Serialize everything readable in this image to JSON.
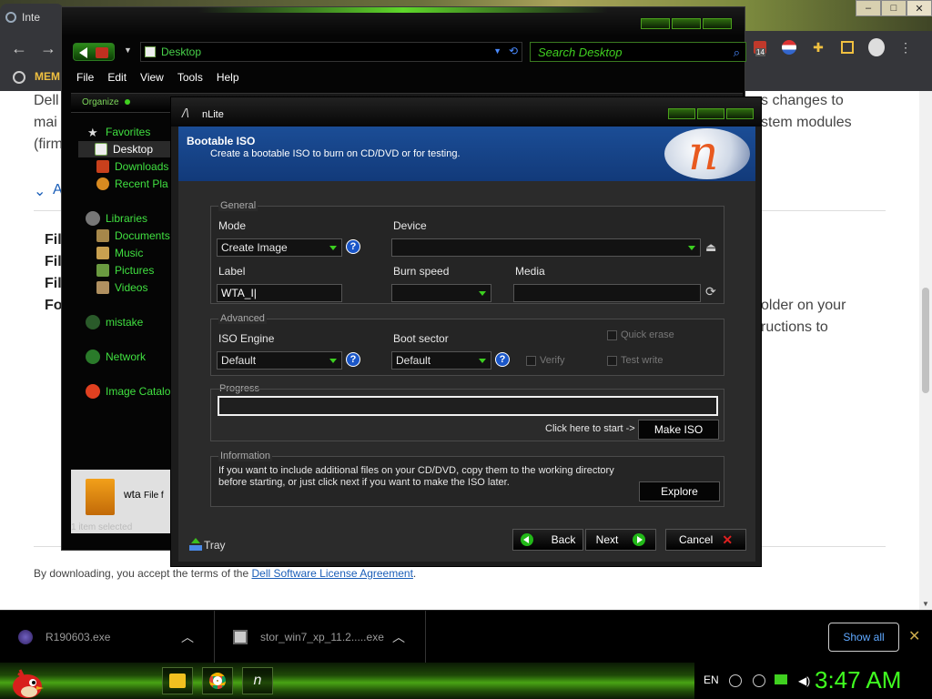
{
  "browser": {
    "tab_title": "Inte",
    "bookmark": "MEM",
    "extension_badge": "14",
    "page_lines": [
      "Dell",
      "mai",
      "(firm",
      "s changes to",
      "stem modules",
      "older on your",
      "ructions to"
    ],
    "section_marker": "A",
    "file_list_prefixes": [
      "Fil",
      "Fil",
      "Fil",
      "Fo"
    ],
    "footer_text": "By downloading, you accept the terms of the",
    "footer_link": "Dell Software License Agreement",
    "footer_end": "."
  },
  "downloads": {
    "items": [
      {
        "name": "R190603.exe"
      },
      {
        "name": "stor_win7_xp_11.2.....exe"
      }
    ],
    "show_all": "Show all"
  },
  "explorer": {
    "address": "Desktop",
    "search_placeholder": "Search Desktop",
    "menu": [
      "File",
      "Edit",
      "View",
      "Tools",
      "Help"
    ],
    "organize": "Organize",
    "nav": [
      {
        "label": "Favorites",
        "icon": "star-icon"
      },
      {
        "label": "Desktop",
        "icon": "desktop-icon"
      },
      {
        "label": "Downloads",
        "icon": "downloads-icon"
      },
      {
        "label": "Recent Pla",
        "icon": "recent-places-icon"
      },
      {
        "label": "Libraries",
        "icon": "libraries-icon"
      },
      {
        "label": "Documents",
        "icon": "documents-icon"
      },
      {
        "label": "Music",
        "icon": "music-icon"
      },
      {
        "label": "Pictures",
        "icon": "pictures-icon"
      },
      {
        "label": "Videos",
        "icon": "videos-icon"
      },
      {
        "label": "mistake",
        "icon": "homegroup-icon"
      },
      {
        "label": "Network",
        "icon": "network-icon"
      },
      {
        "label": "Image Catalo",
        "icon": "image-catalog-icon"
      }
    ],
    "selected_file": "wta",
    "selected_file_type": "File f",
    "status": "1 item selected"
  },
  "nlite": {
    "title": "nLite",
    "header_title": "Bootable ISO",
    "header_subtitle": "Create a bootable ISO to burn on CD/DVD or for testing.",
    "general": {
      "group": "General",
      "mode_label": "Mode",
      "mode_value": "Create Image",
      "device_label": "Device",
      "device_value": "",
      "label_label": "Label",
      "label_value": "WTA_I",
      "burn_speed_label": "Burn speed",
      "burn_speed_value": "",
      "media_label": "Media",
      "media_value": ""
    },
    "advanced": {
      "group": "Advanced",
      "iso_engine_label": "ISO Engine",
      "iso_engine_value": "Default",
      "boot_sector_label": "Boot sector",
      "boot_sector_value": "Default",
      "verify_label": "Verify",
      "quick_erase_label": "Quick erase",
      "test_write_label": "Test write"
    },
    "progress": {
      "group": "Progress",
      "percent": 0,
      "hint": "Click here to start ->",
      "make_iso": "Make ISO"
    },
    "information": {
      "group": "Information",
      "text_line1": "If you want to include additional files on your CD/DVD, copy them to the working directory",
      "text_line2": "before starting, or just click next if you want to make the ISO later.",
      "explore": "Explore"
    },
    "footer": {
      "tray": "Tray",
      "back": "Back",
      "next": "Next",
      "cancel": "Cancel"
    }
  },
  "taskbar": {
    "lang": "EN",
    "clock": "3:47 AM"
  },
  "colors": {
    "accent_green": "#40ff20",
    "header_blue": "#1b4d96",
    "link_blue": "#1a5eb8"
  }
}
